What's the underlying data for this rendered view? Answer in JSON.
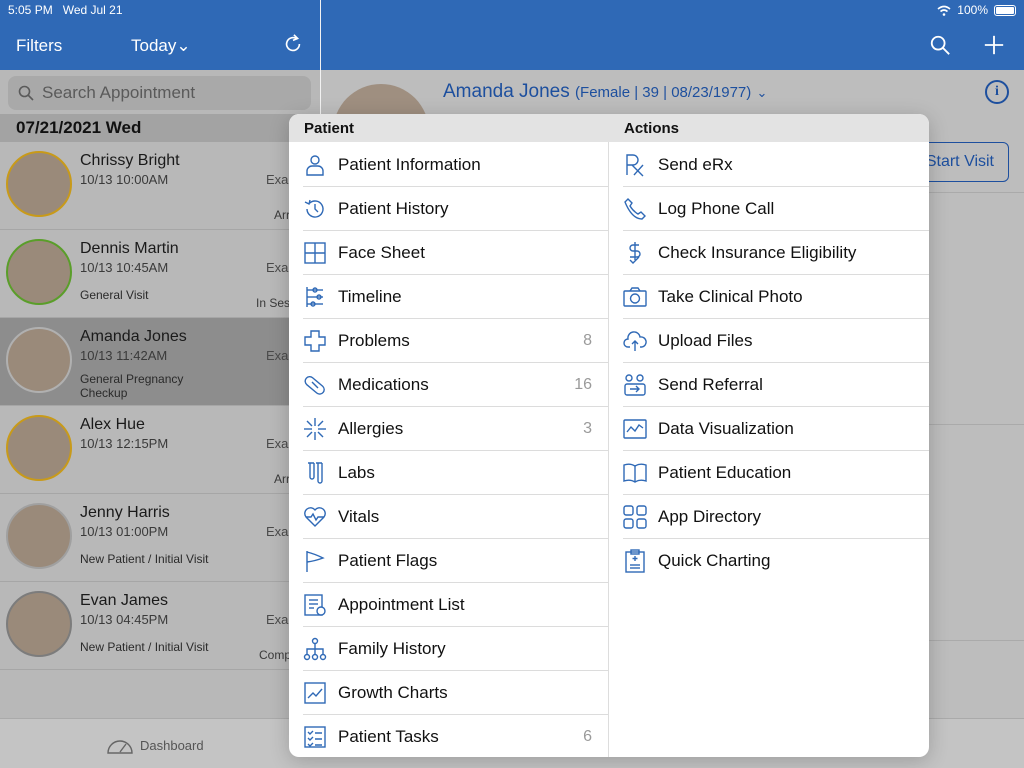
{
  "status_bar": {
    "time": "5:05 PM",
    "date": "Wed Jul 21",
    "battery": "100%"
  },
  "left_nav": {
    "filters": "Filters",
    "today": "Today⌄"
  },
  "search": {
    "placeholder": "Search Appointment"
  },
  "list": {
    "date_header": "07/21/2021 Wed",
    "appointments": [
      {
        "name": "Chrissy Bright",
        "time": "10/13 10:00AM",
        "visit": "",
        "side1": "Exa",
        "side2": "Arr"
      },
      {
        "name": "Dennis Martin",
        "time": "10/13 10:45AM",
        "visit": "General Visit",
        "side1": "Exa",
        "side2": "In Ses"
      },
      {
        "name": "Amanda Jones",
        "time": "10/13 11:42AM",
        "visit": "General Pregnancy Checkup",
        "side1": "Exa",
        "side2": ""
      },
      {
        "name": "Alex Hue",
        "time": "10/13 12:15PM",
        "visit": "",
        "side1": "Exa",
        "side2": "Arr"
      },
      {
        "name": "Jenny Harris",
        "time": "10/13 01:00PM",
        "visit": "New Patient / Initial Visit",
        "side1": "Exa",
        "side2": ""
      },
      {
        "name": "Evan James",
        "time": "10/13 04:45PM",
        "visit": "New Patient / Initial Visit",
        "side1": "Exa",
        "side2": "Comp"
      }
    ]
  },
  "bottom": {
    "dashboard": "Dashboard"
  },
  "patient": {
    "name": "Amanda Jones",
    "meta": "(Female | 39 | 08/23/1977)",
    "start_visit": "Start Visit"
  },
  "popover": {
    "patient_title": "Patient",
    "actions_title": "Actions",
    "patient_items": [
      {
        "label": "Patient Information",
        "count": "",
        "icon": "person-icon"
      },
      {
        "label": "Patient History",
        "count": "",
        "icon": "history-icon"
      },
      {
        "label": "Face Sheet",
        "count": "",
        "icon": "grid-icon"
      },
      {
        "label": "Timeline",
        "count": "",
        "icon": "timeline-icon"
      },
      {
        "label": "Problems",
        "count": "8",
        "icon": "cross-icon"
      },
      {
        "label": "Medications",
        "count": "16",
        "icon": "pill-icon"
      },
      {
        "label": "Allergies",
        "count": "3",
        "icon": "burst-icon"
      },
      {
        "label": "Labs",
        "count": "",
        "icon": "flask-icon"
      },
      {
        "label": "Vitals",
        "count": "",
        "icon": "heart-pulse-icon"
      },
      {
        "label": "Patient Flags",
        "count": "",
        "icon": "flag-icon"
      },
      {
        "label": "Appointment List",
        "count": "",
        "icon": "calendar-list-icon"
      },
      {
        "label": "Family History",
        "count": "",
        "icon": "family-tree-icon"
      },
      {
        "label": "Growth Charts",
        "count": "",
        "icon": "chart-icon"
      },
      {
        "label": "Patient Tasks",
        "count": "6",
        "icon": "checklist-icon"
      }
    ],
    "action_items": [
      {
        "label": "Send eRx",
        "icon": "rx-icon"
      },
      {
        "label": "Log Phone Call",
        "icon": "phone-icon"
      },
      {
        "label": "Check Insurance Eligibility",
        "icon": "dollar-check-icon"
      },
      {
        "label": "Take Clinical Photo",
        "icon": "camera-icon"
      },
      {
        "label": "Upload Files",
        "icon": "cloud-upload-icon"
      },
      {
        "label": "Send Referral",
        "icon": "referral-icon"
      },
      {
        "label": "Data Visualization",
        "icon": "line-chart-icon"
      },
      {
        "label": "Patient Education",
        "icon": "book-icon"
      },
      {
        "label": "App Directory",
        "icon": "apps-icon"
      },
      {
        "label": "Quick Charting",
        "icon": "clipboard-icon"
      }
    ]
  }
}
